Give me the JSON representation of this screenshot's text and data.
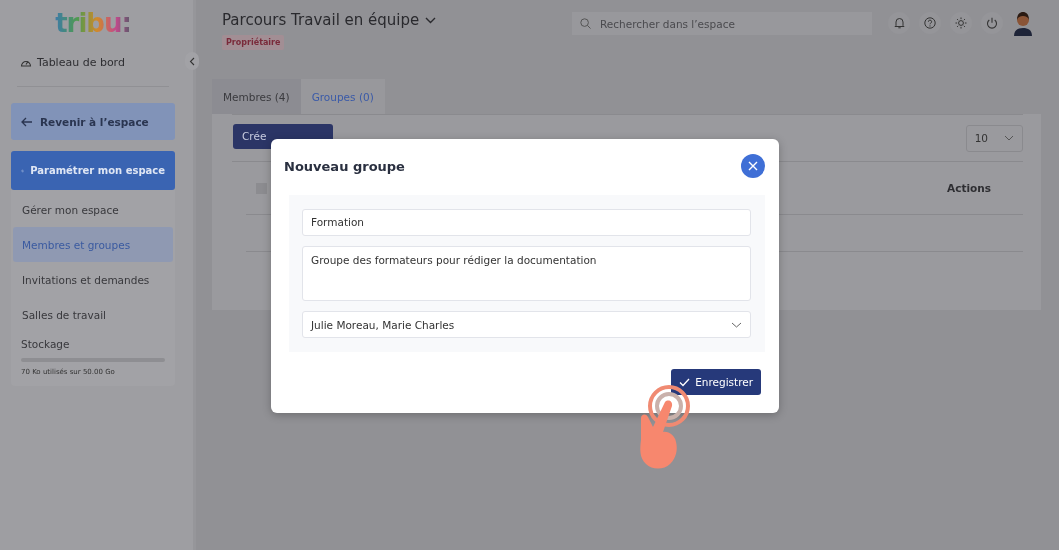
{
  "logo": "tribu:",
  "sidebar": {
    "dashboard": "Tableau de bord",
    "back_button": "Revenir à l’espace",
    "settings_button": "Paramétrer mon espace",
    "items": [
      {
        "label": "Gérer mon espace",
        "selected": false
      },
      {
        "label": "Membres et groupes",
        "selected": true
      },
      {
        "label": "Invitations et demandes",
        "selected": false
      },
      {
        "label": "Salles de travail",
        "selected": false
      }
    ],
    "storage": {
      "label": "Stockage",
      "usage": "70 Ko utilisés sur 50.00 Go"
    }
  },
  "header": {
    "title": "Parcours Travail en équipe",
    "badge": "Propriétaire",
    "search": {
      "placeholder": "Rechercher dans l’espace"
    }
  },
  "tabs": [
    {
      "label": "Membres (4)",
      "selected": false
    },
    {
      "label": "Groupes (0)",
      "selected": true
    }
  ],
  "card": {
    "create_button": "Crée",
    "select_all": {
      "checked": false
    },
    "page_size": "10",
    "columns": [
      "Actions"
    ]
  },
  "modal": {
    "title": "Nouveau groupe",
    "name": "Formation",
    "description": "Groupe des formateurs pour rédiger la documentation",
    "members": "Julie Moreau, Marie Charles",
    "save_button": "Enregistrer"
  }
}
